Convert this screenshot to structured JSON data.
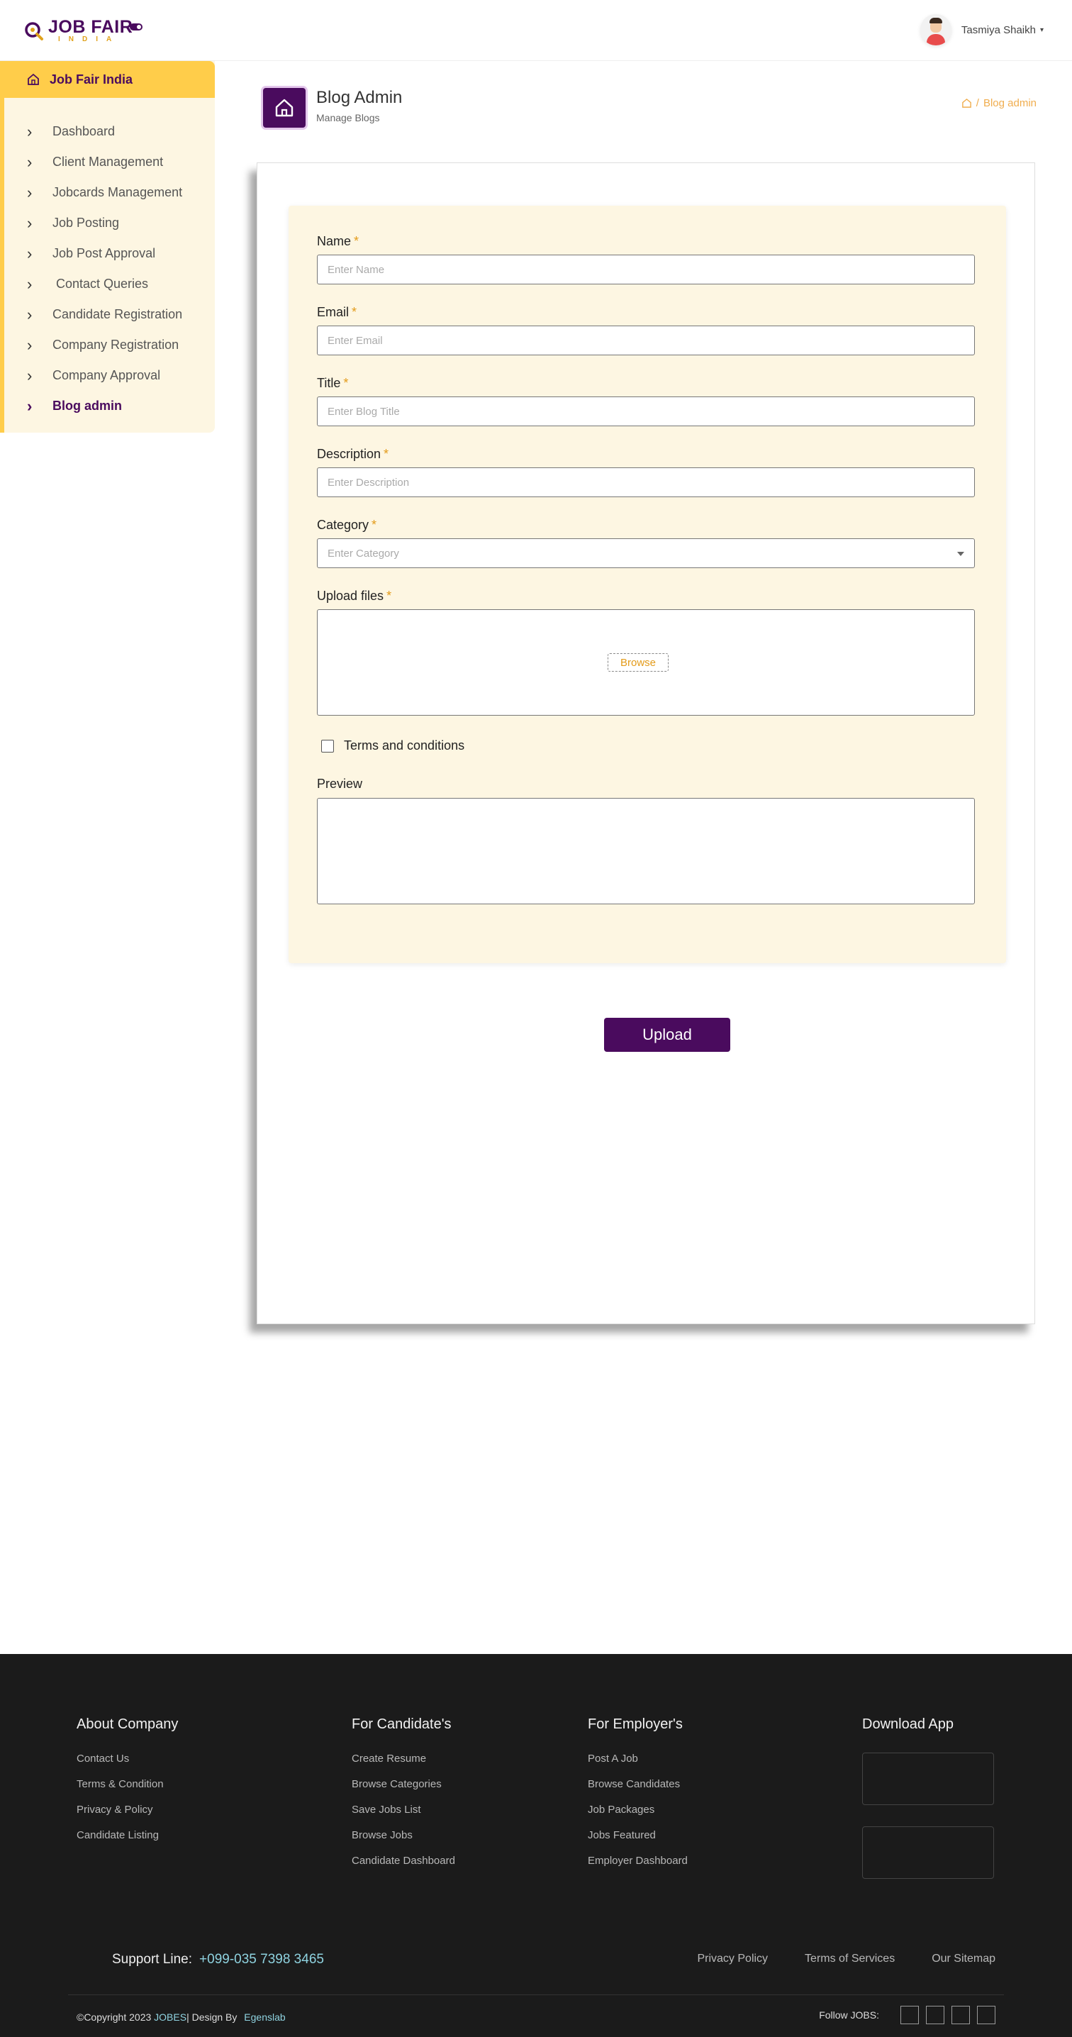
{
  "brand": {
    "name_line1": "JOB FAIR",
    "name_line2": "INDIA"
  },
  "user": {
    "name": "Tasmiya Shaikh"
  },
  "sidebar": {
    "header": "Job Fair India",
    "items": [
      {
        "label": "Dashboard"
      },
      {
        "label": "Client Management"
      },
      {
        "label": "Jobcards Management"
      },
      {
        "label": "Job Posting"
      },
      {
        "label": "Job Post Approval"
      },
      {
        "label": " Contact Queries"
      },
      {
        "label": "Candidate Registration"
      },
      {
        "label": "Company Registration"
      },
      {
        "label": "Company Approval"
      },
      {
        "label": "Blog admin"
      }
    ],
    "active_index": 9
  },
  "page": {
    "title": "Blog Admin",
    "subtitle": "Manage Blogs",
    "breadcrumb": "Blog admin",
    "breadcrumb_sep": "/"
  },
  "form": {
    "name": {
      "label": "Name",
      "placeholder": "Enter Name"
    },
    "email": {
      "label": "Email",
      "placeholder": "Enter Email"
    },
    "title": {
      "label": "Title",
      "placeholder": "Enter Blog Title"
    },
    "description": {
      "label": "Description",
      "placeholder": "Enter Description"
    },
    "category": {
      "label": "Category",
      "placeholder": "Enter Category"
    },
    "upload": {
      "label": "Upload files",
      "browse": "Browse"
    },
    "terms": {
      "label": "Terms and conditions"
    },
    "preview": {
      "label": "Preview"
    },
    "required_mark": "*",
    "submit": "Upload"
  },
  "footer": {
    "about": {
      "heading": "About Company",
      "links": [
        "Contact Us",
        "Terms & Condition",
        "Privacy & Policy",
        "Candidate Listing"
      ]
    },
    "candidates": {
      "heading": "For Candidate's",
      "links": [
        "Create Resume",
        "Browse Categories",
        "Save Jobs List",
        "Browse Jobs",
        "Candidate Dashboard"
      ]
    },
    "employers": {
      "heading": "For Employer's",
      "links": [
        "Post A Job",
        "Browse Candidates",
        "Job Packages",
        "Jobs Featured",
        "Employer Dashboard"
      ]
    },
    "app": {
      "heading": "Download App"
    },
    "support_label": "Support Line:",
    "support_phone": "+099-035 7398 3465",
    "bottom_links": [
      "Privacy Policy",
      "Terms of Services",
      "Our Sitemap"
    ],
    "copyright_prefix": "©Copyright 2023 ",
    "copyright_brand": "JOBES",
    "copyright_mid": "| Design By ",
    "copyright_designer": "Egenslab",
    "follow_label": "Follow JOBS:"
  },
  "colors": {
    "primary": "#4a0b5e",
    "accent": "#ffcd4a",
    "panel": "#fdf6e2",
    "footer": "#1b1b1b"
  }
}
